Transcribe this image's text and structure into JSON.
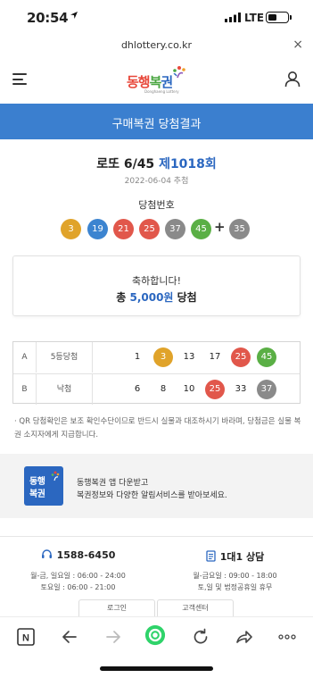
{
  "status_bar": {
    "time": "20:54",
    "network": "LTE"
  },
  "browser": {
    "url": "dhlottery.co.kr",
    "close_label": "×"
  },
  "site_header": {
    "logo_text_1": "동행",
    "logo_text_2": "복",
    "logo_text_3": "권",
    "logo_sub": "Donghaeng Lottery"
  },
  "title_bar": {
    "title": "구매복권 당첨결과"
  },
  "draw": {
    "game": "로또 6/45",
    "round": "제1018회",
    "date": "2022-06-04 추첨",
    "winning_label": "당첨번호",
    "numbers": [
      {
        "value": "3",
        "color": "#e0a32a"
      },
      {
        "value": "19",
        "color": "#3c84d0"
      },
      {
        "value": "21",
        "color": "#e1574b"
      },
      {
        "value": "25",
        "color": "#e1574b"
      },
      {
        "value": "37",
        "color": "#8a8a8a"
      },
      {
        "value": "45",
        "color": "#5aaf45"
      }
    ],
    "plus": "+",
    "bonus": {
      "value": "35",
      "color": "#8a8a8a"
    }
  },
  "prize": {
    "congrats": "축하합니다!",
    "prefix": "총 ",
    "amount": "5,000원",
    "suffix": " 당첨"
  },
  "tickets": [
    {
      "slot": "A",
      "result": "5등당첨",
      "numbers": [
        {
          "value": "1",
          "hit": false,
          "color": ""
        },
        {
          "value": "3",
          "hit": true,
          "color": "#e0a32a"
        },
        {
          "value": "13",
          "hit": false,
          "color": ""
        },
        {
          "value": "17",
          "hit": false,
          "color": ""
        },
        {
          "value": "25",
          "hit": true,
          "color": "#e1574b"
        },
        {
          "value": "45",
          "hit": true,
          "color": "#5aaf45"
        }
      ]
    },
    {
      "slot": "B",
      "result": "낙첨",
      "numbers": [
        {
          "value": "6",
          "hit": false,
          "color": ""
        },
        {
          "value": "8",
          "hit": false,
          "color": ""
        },
        {
          "value": "10",
          "hit": false,
          "color": ""
        },
        {
          "value": "25",
          "hit": true,
          "color": "#e1574b"
        },
        {
          "value": "33",
          "hit": false,
          "color": ""
        },
        {
          "value": "37",
          "hit": true,
          "color": "#8a8a8a"
        }
      ]
    }
  ],
  "notice": "· QR 당첨확인은 보조 확인수단이므로 반드시 실물과 대조하시기 바라며, 당첨금은 실물 복권 소지자에게 지급합니다.",
  "app_banner": {
    "icon_text_1": "동행",
    "icon_text_2": "복권",
    "line1": "동행복권 앱 다운받고",
    "line2": "복권정보와 다양한 알림서비스를 받아보세요."
  },
  "footer": {
    "phone": "1588-6450",
    "phone_hours_1": "월-금, 일요일 : 06:00 - 24:00",
    "phone_hours_2": "토요일 : 06:00 - 21:00",
    "chat": "1대1 상담",
    "chat_hours_1": "월-금요일 : 09:00 - 18:00",
    "chat_hours_2": "토,일 및 법정공휴일 휴무",
    "login_label": "로그인",
    "support_label": "고객센터"
  },
  "colors": {
    "accent": "#3b7fcf",
    "brand_blue": "#2b67c0"
  },
  "toolbar": {
    "icons": [
      "naver-n-icon",
      "back-arrow-icon",
      "forward-arrow-icon",
      "green-dot-icon",
      "reload-icon",
      "share-icon",
      "more-icon"
    ],
    "naver_letter": "N",
    "more_label": "ooo"
  }
}
